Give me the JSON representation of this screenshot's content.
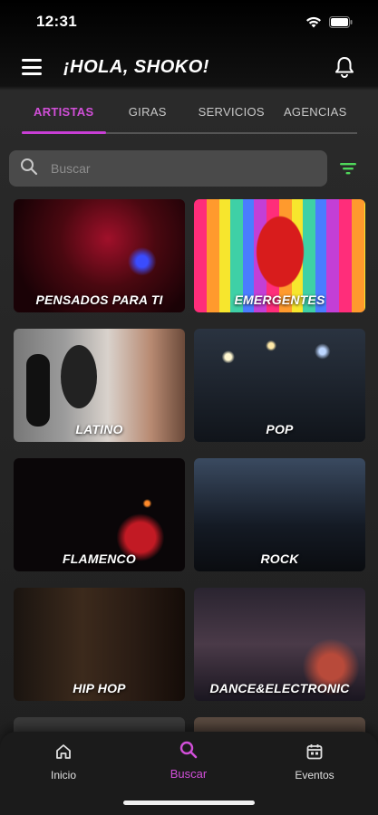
{
  "status_bar": {
    "time": "12:31"
  },
  "header": {
    "greeting": "¡HOLA, SHOKO!"
  },
  "tabs": [
    {
      "label": "ARTISTAS",
      "active": true
    },
    {
      "label": "GIRAS",
      "active": false
    },
    {
      "label": "SERVICIOS",
      "active": false
    },
    {
      "label": "AGENCIAS",
      "active": false
    }
  ],
  "search": {
    "placeholder": "Buscar",
    "value": ""
  },
  "categories": [
    {
      "label": "PENSADOS PARA TI"
    },
    {
      "label": "EMERGENTES"
    },
    {
      "label": "LATINO"
    },
    {
      "label": "POP"
    },
    {
      "label": "FLAMENCO"
    },
    {
      "label": "ROCK"
    },
    {
      "label": "HIP HOP"
    },
    {
      "label": "DANCE&ELECTRONIC"
    }
  ],
  "bottom_nav": {
    "home_label": "Inicio",
    "search_label": "Buscar",
    "events_label": "Eventos"
  },
  "colors": {
    "accent": "#d14fd8",
    "filter_icon": "#4fd65a",
    "background": "#262626"
  },
  "icons": {
    "menu": "menu-icon",
    "bell": "bell-icon",
    "search": "search-icon",
    "filter": "filter-icon",
    "home": "home-icon",
    "events": "calendar-icon",
    "wifi": "wifi-icon",
    "battery": "battery-icon"
  }
}
